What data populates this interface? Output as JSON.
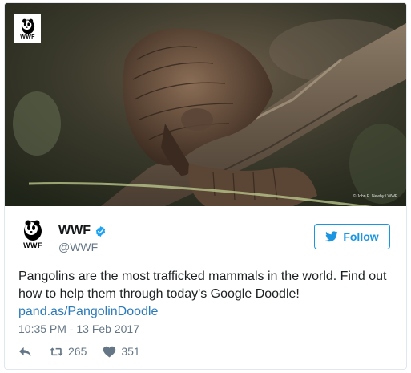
{
  "photo": {
    "logo_text": "WWF",
    "credit": "© John E. Newby / WWF"
  },
  "author": {
    "logo_text": "WWF",
    "display_name": "WWF",
    "handle": "@WWF",
    "verified": true
  },
  "follow_button": {
    "label": "Follow",
    "icon": "twitter-bird-icon"
  },
  "tweet": {
    "text": "Pangolins are the most trafficked mammals in the world. Find out how to help them through today's Google Doodle!",
    "link": "pand.as/PangolinDoodle",
    "timestamp": "10:35 PM - 13 Feb 2017"
  },
  "actions": {
    "reply_icon": "reply-icon",
    "retweet_icon": "retweet-icon",
    "retweet_count": "265",
    "like_icon": "heart-icon",
    "like_count": "351"
  },
  "colors": {
    "link": "#2b7bb9",
    "follow": "#1b95e0",
    "muted": "#657786",
    "verified": "#1da1f2"
  }
}
